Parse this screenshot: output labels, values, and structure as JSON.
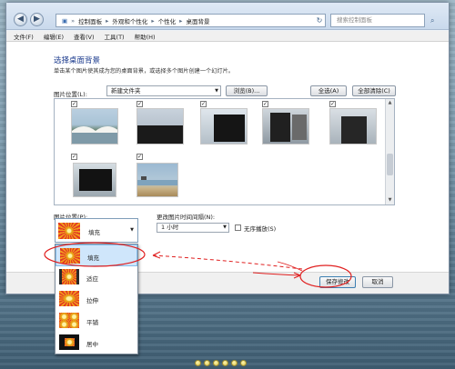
{
  "address_bar": {
    "breadcrumb": [
      "控制面板",
      "外观和个性化",
      "个性化",
      "桌面背景"
    ],
    "search_placeholder": "搜索控制面板"
  },
  "menu": [
    "文件(F)",
    "编辑(E)",
    "查看(V)",
    "工具(T)",
    "帮助(H)"
  ],
  "page": {
    "title": "选择桌面背景",
    "subtitle": "单击某个图片使其成为您的桌面背景，或选择多个图片创建一个幻灯片。",
    "location_label": "图片位置(L):",
    "location_value": "新建文件夹",
    "browse_label": "浏览(B)...",
    "select_all_label": "全选(A)",
    "clear_all_label": "全部清除(C)"
  },
  "gallery": {
    "check_glyph": "✓"
  },
  "position": {
    "label": "图片位置(P):",
    "selected": "填充",
    "options": [
      "填充",
      "适应",
      "拉伸",
      "平铺",
      "居中"
    ]
  },
  "interval": {
    "label": "更改图片时间间隔(N):",
    "value": "1 小时"
  },
  "shuffle": {
    "label": "无序播放(S)",
    "checked": false
  },
  "footer": {
    "save_label": "保存修改",
    "cancel_label": "取消"
  },
  "colors": {
    "accent": "#1e3d8f",
    "annotation": "#e02020",
    "selection": "#cfe6fb"
  },
  "icons": {
    "back": "back-arrow-icon",
    "forward": "forward-arrow-icon",
    "refresh": "refresh-icon",
    "search": "search-icon",
    "chevron": "chevron-down-icon",
    "checkbox": "checkbox-icon"
  }
}
